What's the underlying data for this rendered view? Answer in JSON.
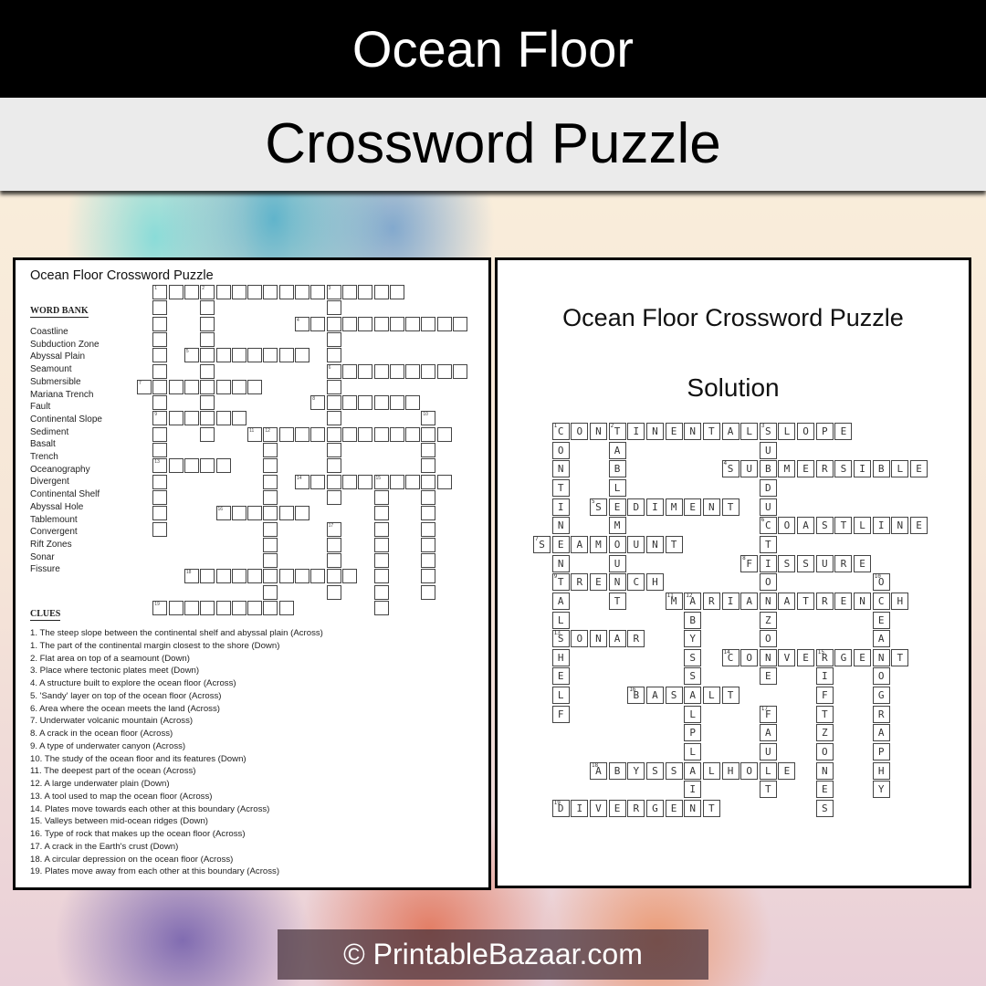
{
  "header": {
    "title": "Ocean Floor",
    "subtitle": "Crossword Puzzle"
  },
  "puzzle_page": {
    "title": "Ocean Floor Crossword Puzzle",
    "word_bank_heading": "WORD BANK",
    "word_bank": [
      "Coastline",
      "Subduction  Zone",
      "Abyssal Plain",
      "Seamount",
      "Submersible",
      "Mariana Trench",
      "Fault",
      "Continental Slope",
      "Sediment",
      "Basalt",
      "Trench",
      "Oceanography",
      "Divergent",
      "Continental Shelf",
      "Abyssal Hole",
      "Tablemount",
      "Convergent",
      "Rift Zones",
      "Sonar",
      "Fissure"
    ],
    "clues_heading": "CLUES",
    "clues": [
      "1. The steep slope between the continental shelf and abyssal plain (Across)",
      "1. The part of the continental margin closest to the shore (Down)",
      "2. Flat area on top of a seamount (Down)",
      "3. Place where tectonic plates meet (Down)",
      "4. A structure built to explore the ocean floor (Across)",
      "5. 'Sandy' layer on top of the ocean floor (Across)",
      "6. Area where the ocean meets the land (Across)",
      "7. Underwater  volcanic mountain (Across)",
      "8. A crack in the ocean floor (Across)",
      "9. A type of underwater  canyon (Across)",
      "10. The study of the ocean floor and its features (Down)",
      "11. The deepest part of the ocean (Across)",
      "12. A large underwater plain (Down)",
      "13. A tool used to map the ocean floor (Across)",
      "14. Plates move towards each other at this boundary (Across)",
      "15. Valleys between mid-ocean ridges (Down)",
      "16. Type of rock that makes up the ocean floor (Across)",
      "17. A crack in the Earth's crust (Down)",
      "18. A circular depression on the ocean floor (Across)",
      "19. Plates move away from each other at this boundary (Across)"
    ]
  },
  "solution_page": {
    "title": "Ocean Floor Crossword Puzzle",
    "subtitle": "Solution"
  },
  "crossword": {
    "entries": [
      {
        "num": 1,
        "dir": "across",
        "row": 0,
        "col": 1,
        "answer": "CONTINENTALSLOPE"
      },
      {
        "num": 1,
        "dir": "down",
        "row": 0,
        "col": 1,
        "answer": "CONTINENTALSHELF"
      },
      {
        "num": 2,
        "dir": "down",
        "row": 0,
        "col": 4,
        "answer": "TABLEMOUNT"
      },
      {
        "num": 3,
        "dir": "down",
        "row": 0,
        "col": 12,
        "answer": "SUBDUCTIONZONE"
      },
      {
        "num": 4,
        "dir": "across",
        "row": 2,
        "col": 10,
        "answer": "SUBMERSIBLE"
      },
      {
        "num": 5,
        "dir": "across",
        "row": 4,
        "col": 3,
        "answer": "SEDIMENT"
      },
      {
        "num": 6,
        "dir": "across",
        "row": 5,
        "col": 12,
        "answer": "COASTLINE"
      },
      {
        "num": 7,
        "dir": "across",
        "row": 6,
        "col": 0,
        "answer": "SEAMOUNT"
      },
      {
        "num": 8,
        "dir": "across",
        "row": 7,
        "col": 11,
        "answer": "FISSURE"
      },
      {
        "num": 9,
        "dir": "across",
        "row": 8,
        "col": 1,
        "answer": "TRENCH"
      },
      {
        "num": 10,
        "dir": "down",
        "row": 8,
        "col": 18,
        "answer": "OCEANOGRAPHY"
      },
      {
        "num": 11,
        "dir": "across",
        "row": 9,
        "col": 7,
        "answer": "MARIANATRENCH"
      },
      {
        "num": 12,
        "dir": "down",
        "row": 9,
        "col": 8,
        "answer": "ABYSSALPLAIN"
      },
      {
        "num": 13,
        "dir": "across",
        "row": 11,
        "col": 1,
        "answer": "SONAR"
      },
      {
        "num": 14,
        "dir": "across",
        "row": 12,
        "col": 10,
        "answer": "CONVERGENT"
      },
      {
        "num": 15,
        "dir": "down",
        "row": 12,
        "col": 15,
        "answer": "RIFTZONES"
      },
      {
        "num": 16,
        "dir": "across",
        "row": 14,
        "col": 5,
        "answer": "BASALT"
      },
      {
        "num": 17,
        "dir": "down",
        "row": 15,
        "col": 12,
        "answer": "FAULT"
      },
      {
        "num": 18,
        "dir": "across",
        "row": 18,
        "col": 3,
        "answer": "ABYSSALHOLE"
      },
      {
        "num": 19,
        "dir": "across",
        "row": 20,
        "col": 1,
        "answer": "DIVERGENT"
      }
    ]
  },
  "footer": {
    "copyright": "© PrintableBazaar.com"
  }
}
